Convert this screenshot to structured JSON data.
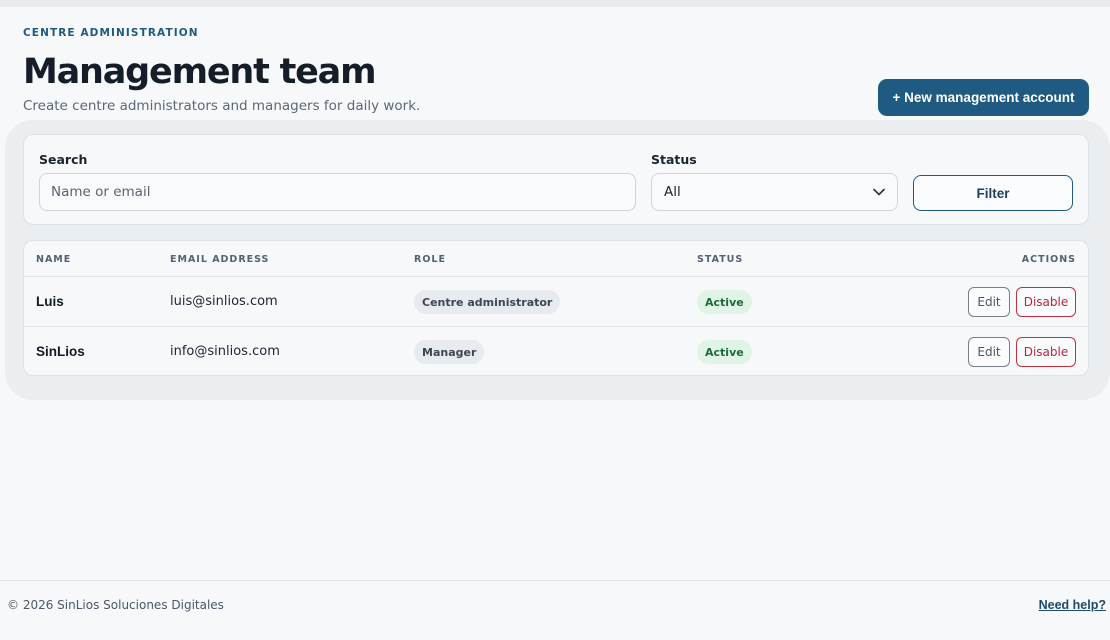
{
  "header": {
    "eyebrow": "CENTRE ADMINISTRATION",
    "title": "Management team",
    "subtitle": "Create centre administrators and managers for daily work.",
    "new_button_label": "+ New management account"
  },
  "filters": {
    "search_label": "Search",
    "search_placeholder": "Name or email",
    "search_value": "",
    "status_label": "Status",
    "status_value": "All",
    "filter_button_label": "Filter"
  },
  "table": {
    "columns": [
      "NAME",
      "EMAIL ADDRESS",
      "ROLE",
      "STATUS",
      "ACTIONS"
    ],
    "rows": [
      {
        "name": "Luis",
        "email": "luis@sinlios.com",
        "role": "Centre administrator",
        "status": "Active",
        "edit_label": "Edit",
        "disable_label": "Disable"
      },
      {
        "name": "SinLios",
        "email": "info@sinlios.com",
        "role": "Manager",
        "status": "Active",
        "edit_label": "Edit",
        "disable_label": "Disable"
      }
    ]
  },
  "footer": {
    "copyright": "© 2026 SinLios Soluciones Digitales",
    "help_link": "Need help?"
  },
  "colors": {
    "accent": "#1f5a82",
    "background": "#f6f8fa",
    "status_active_bg": "#dff3e6",
    "status_active_text": "#1d6b3a",
    "danger": "#b8263a"
  },
  "icons": {
    "status_dropdown": "chevron-down-icon"
  }
}
